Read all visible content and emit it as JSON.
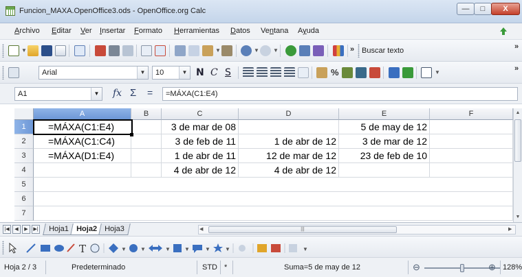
{
  "window": {
    "title": "Funcion_MAXA.OpenOffice3.ods - OpenOffice.org Calc",
    "minimize": "—",
    "maximize": "□",
    "close": "X"
  },
  "menu": [
    {
      "label": "Archivo",
      "accel": "A",
      "rest": "rchivo"
    },
    {
      "label": "Editar",
      "accel": "E",
      "rest": "ditar"
    },
    {
      "label": "Ver",
      "accel": "V",
      "rest": "er"
    },
    {
      "label": "Insertar",
      "accel": "I",
      "rest": "nsertar"
    },
    {
      "label": "Formato",
      "accel": "F",
      "rest": "ormato"
    },
    {
      "label": "Herramientas",
      "accel": "H",
      "rest": "erramientas"
    },
    {
      "label": "Datos",
      "accel": "D",
      "rest": "atos"
    },
    {
      "label": "Ventana",
      "accel": "n",
      "prefix": "Ve",
      "rest": "tana"
    },
    {
      "label": "Ayuda",
      "accel": "y",
      "prefix": "A",
      "rest": "uda"
    }
  ],
  "toolbar": {
    "search_label": "Buscar texto",
    "font_name": "Arial",
    "font_size": "10",
    "bold": "N",
    "italic": "C",
    "underline": "S",
    "currency": "%"
  },
  "formula_bar": {
    "cell_ref": "A1",
    "formula": "=MÁXA(C1:E4)"
  },
  "grid": {
    "columns": [
      "A",
      "B",
      "C",
      "D",
      "E",
      "F"
    ],
    "rows": [
      "1",
      "2",
      "3",
      "4",
      "5",
      "6",
      "7"
    ],
    "cells": {
      "A1": "=MÁXA(C1:E4)",
      "A2": "=MÁXA(C1:C4)",
      "A3": "=MÁXA(D1:E4)",
      "C1": "3 de mar de 08",
      "C2": "3 de feb de 11",
      "C3": "1 de abr de 11",
      "C4": "4 de abr de 12",
      "D2": "1 de abr de 12",
      "D3": "12 de mar de 12",
      "D4": "4 de abr de 12",
      "E1": "5 de may de 12",
      "E2": "3 de mar de 12",
      "E3": "23 de feb de 10"
    },
    "active_cell": "A1"
  },
  "sheets": {
    "tabs": [
      "Hoja1",
      "Hoja2",
      "Hoja3"
    ],
    "active": "Hoja2"
  },
  "status": {
    "sheet": "Hoja 2 / 3",
    "style": "Predeterminado",
    "mode": "STD",
    "modified": "*",
    "sum": "Suma=5 de may de 12",
    "zoom": "128%"
  },
  "colors": {
    "selection_header": "#7aa3de",
    "titlebar": "#c4d5ea",
    "close_button": "#c4402a"
  }
}
